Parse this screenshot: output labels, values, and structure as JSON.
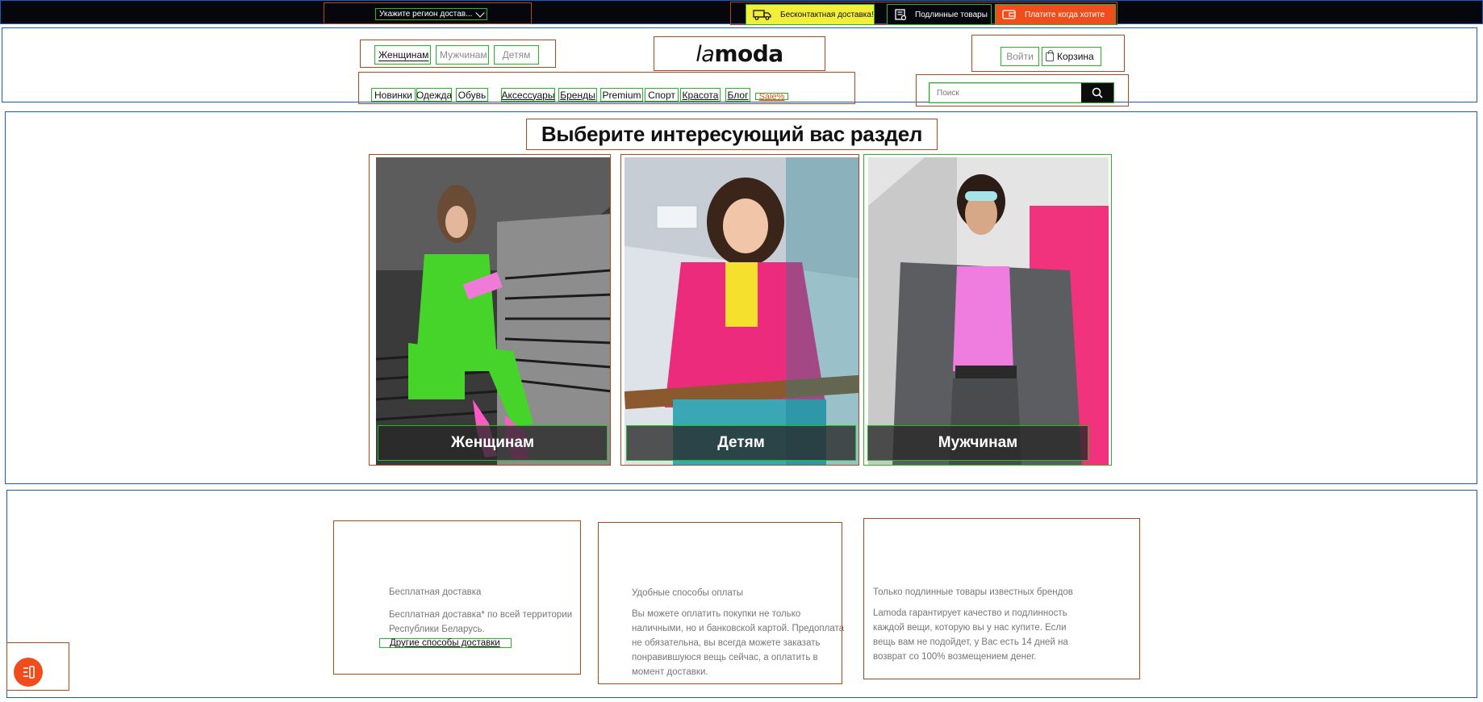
{
  "topbar": {
    "region_label": "Укажите регион достав...",
    "promos": [
      {
        "label": "Бесконтактная доставка!",
        "icon": "truck-icon"
      },
      {
        "label": "Подлинные товары",
        "icon": "certificate-icon"
      },
      {
        "label": "Платите когда хотите",
        "icon": "wallet-icon"
      }
    ]
  },
  "header": {
    "gender_tabs": [
      {
        "label": "Женщинам",
        "active": true
      },
      {
        "label": "Мужчинам",
        "active": false
      },
      {
        "label": "Детям",
        "active": false
      }
    ],
    "logo": {
      "prefix": "la",
      "suffix": "moda"
    },
    "login_label": "Войти",
    "cart_label": "Корзина",
    "categories": [
      "Новинки",
      "Одежда",
      "Обувь",
      "Аксессуары",
      "Бренды",
      "Premium",
      "Спорт",
      "Красота",
      "Блог",
      "Sale%"
    ],
    "search": {
      "placeholder": "Поиск"
    }
  },
  "main": {
    "title": "Выберите интересующий вас раздел",
    "cards": [
      {
        "label": "Женщинам"
      },
      {
        "label": "Детям"
      },
      {
        "label": "Мужчинам"
      }
    ]
  },
  "benefits": [
    {
      "title": "Бесплатная доставка",
      "text": "Бесплатная доставка* по всей территории Республики Беларусь.",
      "link": "Другие способы доставки"
    },
    {
      "title": "Удобные способы оплаты",
      "text": "Вы можете оплатить покупки не только наличными, но и банковской картой. Предоплата не обязательна, вы всегда можете заказать понравившуюся вещь сейчас, а оплатить в момент доставки."
    },
    {
      "title": "Только подлинные товары известных брендов",
      "text": "Lamoda гарантирует качество и подлинность каждой вещи, которую вы у нас купите. Если вещь вам не подойдет, у Вас есть 14 дней на возврат со 100% возмещением денег."
    }
  ],
  "colors": {
    "accent": "#ef4e1c",
    "promo_yellow": "#f3ee3a",
    "topbar_bg": "#06070c"
  }
}
